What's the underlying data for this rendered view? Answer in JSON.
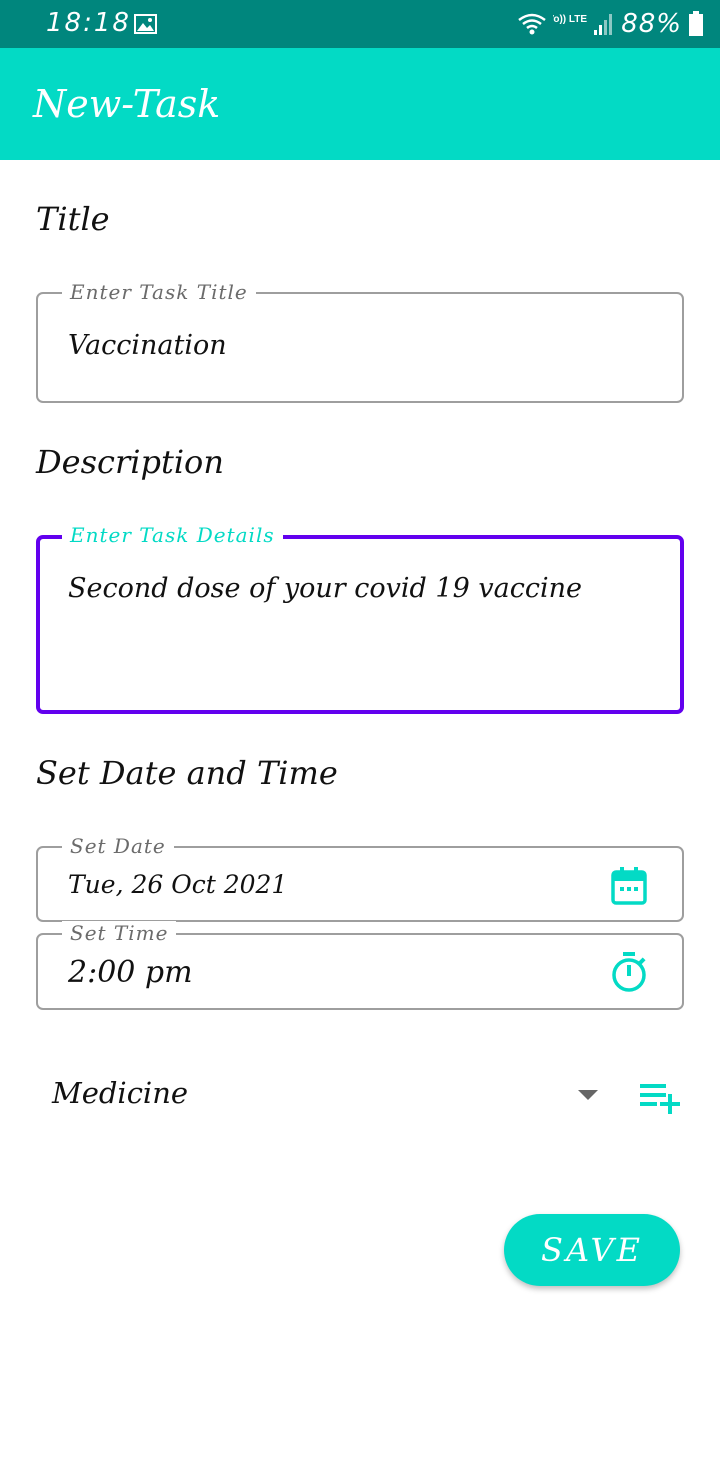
{
  "status_bar": {
    "time": "18:18",
    "network_label": "Vo)) LTE1",
    "battery": "88%"
  },
  "app_bar": {
    "title": "New-Task"
  },
  "sections": {
    "title_heading": "Title",
    "description_heading": "Description",
    "datetime_heading": "Set Date and Time"
  },
  "fields": {
    "task_title": {
      "label": "Enter Task Title",
      "value": "Vaccination"
    },
    "task_details": {
      "label": "Enter Task Details",
      "value": "Second dose of your covid 19 vaccine"
    },
    "date": {
      "label": "Set Date",
      "value": "Tue, 26 Oct 2021",
      "icon": "calendar-icon"
    },
    "time": {
      "label": "Set Time",
      "value": "2:00 pm",
      "icon": "timer-icon"
    }
  },
  "category": {
    "selected": "Medicine",
    "add_icon": "playlist-add-icon"
  },
  "actions": {
    "save_label": "SAVE"
  },
  "colors": {
    "status_bar": "#00867d",
    "accent": "#03dac5",
    "focus_border": "#6200ee",
    "outline": "#9e9e9e"
  }
}
